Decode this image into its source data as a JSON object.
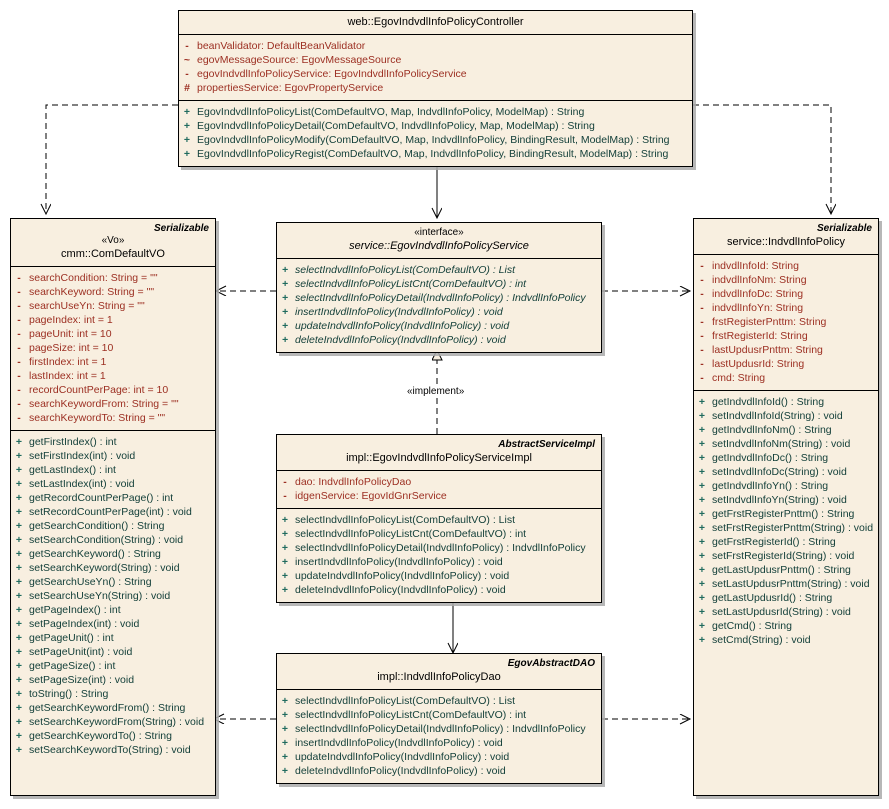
{
  "diagram": {
    "title": "EgovIndvdlInfoPolicy class diagram",
    "colors": {
      "box_fill": "#f8efe0",
      "border": "#000000",
      "attribute": "#9c2f22",
      "method": "#14403a",
      "background": "#ffffff"
    }
  },
  "classes": {
    "controller": {
      "name": "web::EgovIndvdlInfoPolicyController",
      "stereotype": "",
      "tag": "",
      "attributes": [
        {
          "vis": "-",
          "text": "beanValidator:  DefaultBeanValidator"
        },
        {
          "vis": "~",
          "text": "egovMessageSource:  EgovMessageSource"
        },
        {
          "vis": "-",
          "text": "egovIndvdlInfoPolicyService:  EgovIndvdlInfoPolicyService"
        },
        {
          "vis": "#",
          "text": "propertiesService:  EgovPropertyService"
        }
      ],
      "methods": [
        {
          "vis": "+",
          "text": "EgovIndvdlInfoPolicyList(ComDefaultVO, Map, IndvdlInfoPolicy, ModelMap) : String"
        },
        {
          "vis": "+",
          "text": "EgovIndvdlInfoPolicyDetail(ComDefaultVO, IndvdlInfoPolicy, Map, ModelMap) : String"
        },
        {
          "vis": "+",
          "text": "EgovIndvdlInfoPolicyModify(ComDefaultVO, Map, IndvdlInfoPolicy, BindingResult, ModelMap) : String"
        },
        {
          "vis": "+",
          "text": "EgovIndvdlInfoPolicyRegist(ComDefaultVO, Map, IndvdlInfoPolicy, BindingResult, ModelMap) : String"
        }
      ]
    },
    "vo": {
      "name": "cmm::ComDefaultVO",
      "stereotype": "«Vo»",
      "tag": "Serializable",
      "attributes": [
        {
          "vis": "-",
          "text": "searchCondition:  String = \"\""
        },
        {
          "vis": "-",
          "text": "searchKeyword:  String = \"\""
        },
        {
          "vis": "-",
          "text": "searchUseYn:  String = \"\""
        },
        {
          "vis": "-",
          "text": "pageIndex:  int = 1"
        },
        {
          "vis": "-",
          "text": "pageUnit:  int = 10"
        },
        {
          "vis": "-",
          "text": "pageSize:  int = 10"
        },
        {
          "vis": "-",
          "text": "firstIndex:  int = 1"
        },
        {
          "vis": "-",
          "text": "lastIndex:  int = 1"
        },
        {
          "vis": "-",
          "text": "recordCountPerPage:  int = 10"
        },
        {
          "vis": "-",
          "text": "searchKeywordFrom:  String = \"\""
        },
        {
          "vis": "-",
          "text": "searchKeywordTo:  String = \"\""
        }
      ],
      "methods": [
        {
          "vis": "+",
          "text": "getFirstIndex() : int"
        },
        {
          "vis": "+",
          "text": "setFirstIndex(int) : void"
        },
        {
          "vis": "+",
          "text": "getLastIndex() : int"
        },
        {
          "vis": "+",
          "text": "setLastIndex(int) : void"
        },
        {
          "vis": "+",
          "text": "getRecordCountPerPage() : int"
        },
        {
          "vis": "+",
          "text": "setRecordCountPerPage(int) : void"
        },
        {
          "vis": "+",
          "text": "getSearchCondition() : String"
        },
        {
          "vis": "+",
          "text": "setSearchCondition(String) : void"
        },
        {
          "vis": "+",
          "text": "getSearchKeyword() : String"
        },
        {
          "vis": "+",
          "text": "setSearchKeyword(String) : void"
        },
        {
          "vis": "+",
          "text": "getSearchUseYn() : String"
        },
        {
          "vis": "+",
          "text": "setSearchUseYn(String) : void"
        },
        {
          "vis": "+",
          "text": "getPageIndex() : int"
        },
        {
          "vis": "+",
          "text": "setPageIndex(int) : void"
        },
        {
          "vis": "+",
          "text": "getPageUnit() : int"
        },
        {
          "vis": "+",
          "text": "setPageUnit(int) : void"
        },
        {
          "vis": "+",
          "text": "getPageSize() : int"
        },
        {
          "vis": "+",
          "text": "setPageSize(int) : void"
        },
        {
          "vis": "+",
          "text": "toString() : String"
        },
        {
          "vis": "+",
          "text": "getSearchKeywordFrom() : String"
        },
        {
          "vis": "+",
          "text": "setSearchKeywordFrom(String) : void"
        },
        {
          "vis": "+",
          "text": "getSearchKeywordTo() : String"
        },
        {
          "vis": "+",
          "text": "setSearchKeywordTo(String) : void"
        }
      ]
    },
    "service": {
      "name": "service::EgovIndvdlInfoPolicyService",
      "stereotype": "«interface»",
      "tag": "",
      "attributes": [],
      "methods": [
        {
          "vis": "+",
          "text": "selectIndvdlInfoPolicyList(ComDefaultVO) : List"
        },
        {
          "vis": "+",
          "text": "selectIndvdlInfoPolicyListCnt(ComDefaultVO) : int"
        },
        {
          "vis": "+",
          "text": "selectIndvdlInfoPolicyDetail(IndvdlInfoPolicy) : IndvdlInfoPolicy"
        },
        {
          "vis": "+",
          "text": "insertIndvdlInfoPolicy(IndvdlInfoPolicy) : void"
        },
        {
          "vis": "+",
          "text": "updateIndvdlInfoPolicy(IndvdlInfoPolicy) : void"
        },
        {
          "vis": "+",
          "text": "deleteIndvdlInfoPolicy(IndvdlInfoPolicy) : void"
        }
      ]
    },
    "serviceimpl": {
      "name": "impl::EgovIndvdlInfoPolicyServiceImpl",
      "stereotype": "",
      "tag": "AbstractServiceImpl",
      "attributes": [
        {
          "vis": "-",
          "text": "dao:  IndvdlInfoPolicyDao"
        },
        {
          "vis": "-",
          "text": "idgenService:  EgovIdGnrService"
        }
      ],
      "methods": [
        {
          "vis": "+",
          "text": "selectIndvdlInfoPolicyList(ComDefaultVO) : List"
        },
        {
          "vis": "+",
          "text": "selectIndvdlInfoPolicyListCnt(ComDefaultVO) : int"
        },
        {
          "vis": "+",
          "text": "selectIndvdlInfoPolicyDetail(IndvdlInfoPolicy) : IndvdlInfoPolicy"
        },
        {
          "vis": "+",
          "text": "insertIndvdlInfoPolicy(IndvdlInfoPolicy) : void"
        },
        {
          "vis": "+",
          "text": "updateIndvdlInfoPolicy(IndvdlInfoPolicy) : void"
        },
        {
          "vis": "+",
          "text": "deleteIndvdlInfoPolicy(IndvdlInfoPolicy) : void"
        }
      ]
    },
    "dao": {
      "name": "impl::IndvdlInfoPolicyDao",
      "stereotype": "",
      "tag": "EgovAbstractDAO",
      "attributes": [],
      "methods": [
        {
          "vis": "+",
          "text": "selectIndvdlInfoPolicyList(ComDefaultVO) : List"
        },
        {
          "vis": "+",
          "text": "selectIndvdlInfoPolicyListCnt(ComDefaultVO) : int"
        },
        {
          "vis": "+",
          "text": "selectIndvdlInfoPolicyDetail(IndvdlInfoPolicy) : IndvdlInfoPolicy"
        },
        {
          "vis": "+",
          "text": "insertIndvdlInfoPolicy(IndvdlInfoPolicy) : void"
        },
        {
          "vis": "+",
          "text": "updateIndvdlInfoPolicy(IndvdlInfoPolicy) : void"
        },
        {
          "vis": "+",
          "text": "deleteIndvdlInfoPolicy(IndvdlInfoPolicy) : void"
        }
      ]
    },
    "model": {
      "name": "service::IndvdlInfoPolicy",
      "stereotype": "",
      "tag": "Serializable",
      "attributes": [
        {
          "vis": "-",
          "text": "indvdlInfoId:  String"
        },
        {
          "vis": "-",
          "text": "indvdlInfoNm:  String"
        },
        {
          "vis": "-",
          "text": "indvdlInfoDc:  String"
        },
        {
          "vis": "-",
          "text": "indvdlInfoYn:  String"
        },
        {
          "vis": "-",
          "text": "frstRegisterPnttm:  String"
        },
        {
          "vis": "-",
          "text": "frstRegisterId:  String"
        },
        {
          "vis": "-",
          "text": "lastUpdusrPnttm:  String"
        },
        {
          "vis": "-",
          "text": "lastUpdusrId:  String"
        },
        {
          "vis": "-",
          "text": "cmd:  String"
        }
      ],
      "methods": [
        {
          "vis": "+",
          "text": "getIndvdlInfoId() : String"
        },
        {
          "vis": "+",
          "text": "setIndvdlInfoId(String) : void"
        },
        {
          "vis": "+",
          "text": "getIndvdlInfoNm() : String"
        },
        {
          "vis": "+",
          "text": "setIndvdlInfoNm(String) : void"
        },
        {
          "vis": "+",
          "text": "getIndvdlInfoDc() : String"
        },
        {
          "vis": "+",
          "text": "setIndvdlInfoDc(String) : void"
        },
        {
          "vis": "+",
          "text": "getIndvdlInfoYn() : String"
        },
        {
          "vis": "+",
          "text": "setIndvdlInfoYn(String) : void"
        },
        {
          "vis": "+",
          "text": "getFrstRegisterPnttm() : String"
        },
        {
          "vis": "+",
          "text": "setFrstRegisterPnttm(String) : void"
        },
        {
          "vis": "+",
          "text": "getFrstRegisterId() : String"
        },
        {
          "vis": "+",
          "text": "setFrstRegisterId(String) : void"
        },
        {
          "vis": "+",
          "text": "getLastUpdusrPnttm() : String"
        },
        {
          "vis": "+",
          "text": "setLastUpdusrPnttm(String) : void"
        },
        {
          "vis": "+",
          "text": "getLastUpdusrId() : String"
        },
        {
          "vis": "+",
          "text": "setLastUpdusrId(String) : void"
        },
        {
          "vis": "+",
          "text": "getCmd() : String"
        },
        {
          "vis": "+",
          "text": "setCmd(String) : void"
        }
      ]
    }
  },
  "connectors": {
    "implement_label": "«implement»"
  }
}
